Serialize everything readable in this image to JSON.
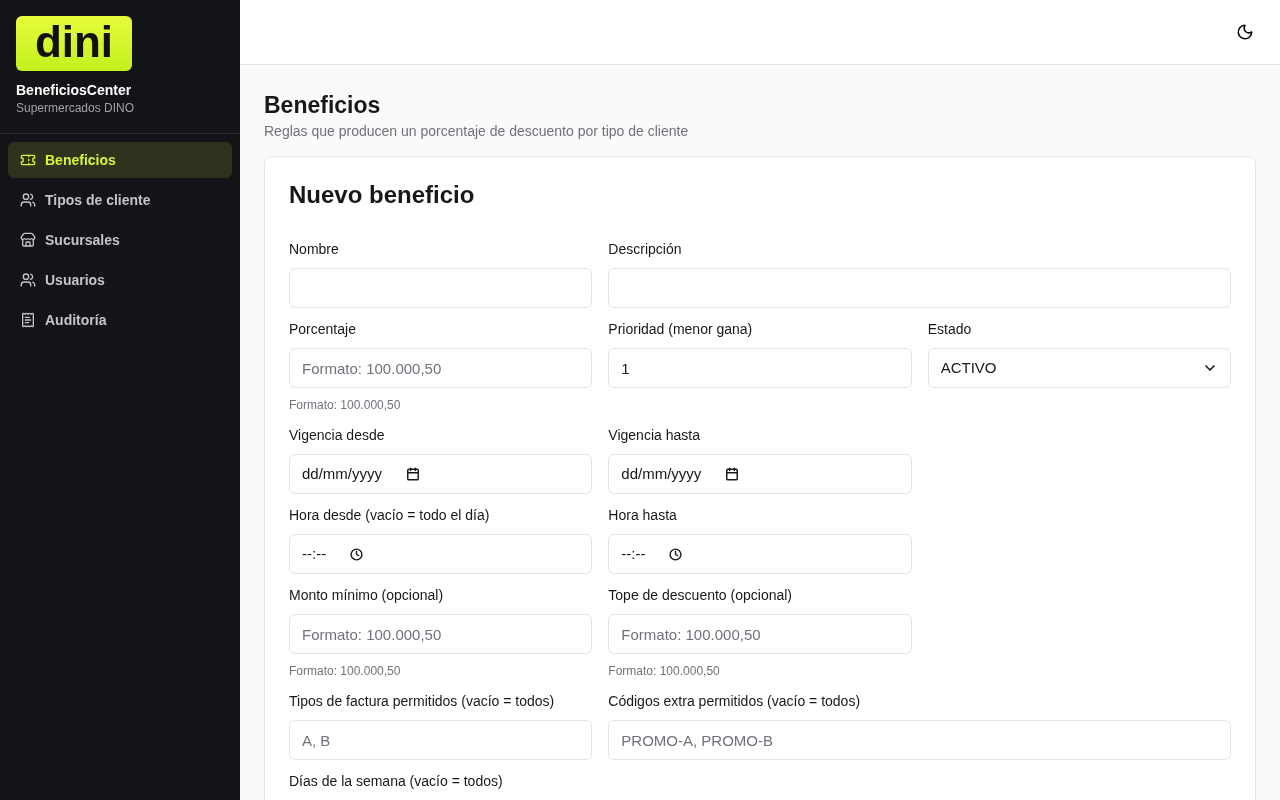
{
  "sidebar": {
    "logo": "dini",
    "app_name": "BeneficiosCenter",
    "company": "Supermercados DINO",
    "items": [
      {
        "label": "Beneficios",
        "selected": true
      },
      {
        "label": "Tipos de cliente",
        "selected": false
      },
      {
        "label": "Sucursales",
        "selected": false
      },
      {
        "label": "Usuarios",
        "selected": false
      },
      {
        "label": "Auditoría",
        "selected": false
      }
    ]
  },
  "page": {
    "title": "Beneficios",
    "subtitle": "Reglas que producen un porcentaje de descuento por tipo de cliente"
  },
  "form": {
    "title": "Nuevo beneficio",
    "rows": [
      [
        {
          "label": "Nombre",
          "kind": "text",
          "wide": false
        },
        {
          "label": "Descripción",
          "kind": "text",
          "wide": true
        }
      ],
      [
        {
          "label": "Porcentaje",
          "kind": "text",
          "placeholder": "Formato: 100.000,50",
          "help": "Formato: 100.000,50",
          "wide": false
        },
        {
          "label": "Prioridad (menor gana)",
          "kind": "text",
          "value": "1",
          "wide": false
        },
        {
          "label": "Estado",
          "kind": "select",
          "value": "ACTIVO",
          "wide": false
        }
      ],
      [
        {
          "label": "Vigencia desde",
          "kind": "date",
          "value": "dd/mm/yyyy",
          "wide": false
        },
        {
          "label": "Vigencia hasta",
          "kind": "date",
          "value": "dd/mm/yyyy",
          "wide": false
        }
      ],
      [
        {
          "label": "Hora desde (vacío = todo el día)",
          "kind": "time",
          "value": "--:--",
          "wide": false
        },
        {
          "label": "Hora hasta",
          "kind": "time",
          "value": "--:--",
          "wide": false
        }
      ],
      [
        {
          "label": "Monto mínimo (opcional)",
          "kind": "text",
          "placeholder": "Formato: 100.000,50",
          "help": "Formato: 100.000,50",
          "wide": false
        },
        {
          "label": "Tope de descuento (opcional)",
          "kind": "text",
          "placeholder": "Formato: 100.000,50",
          "help": "Formato: 100.000,50",
          "wide": false
        }
      ],
      [
        {
          "label": "Tipos de factura permitidos (vacío = todos)",
          "kind": "text",
          "placeholder": "A, B",
          "wide": false
        },
        {
          "label": "Códigos extra permitidos (vacío = todos)",
          "kind": "text",
          "placeholder": "PROMO-A, PROMO-B",
          "wide": true
        }
      ]
    ],
    "days_label": "Días de la semana (vacío = todos)"
  }
}
